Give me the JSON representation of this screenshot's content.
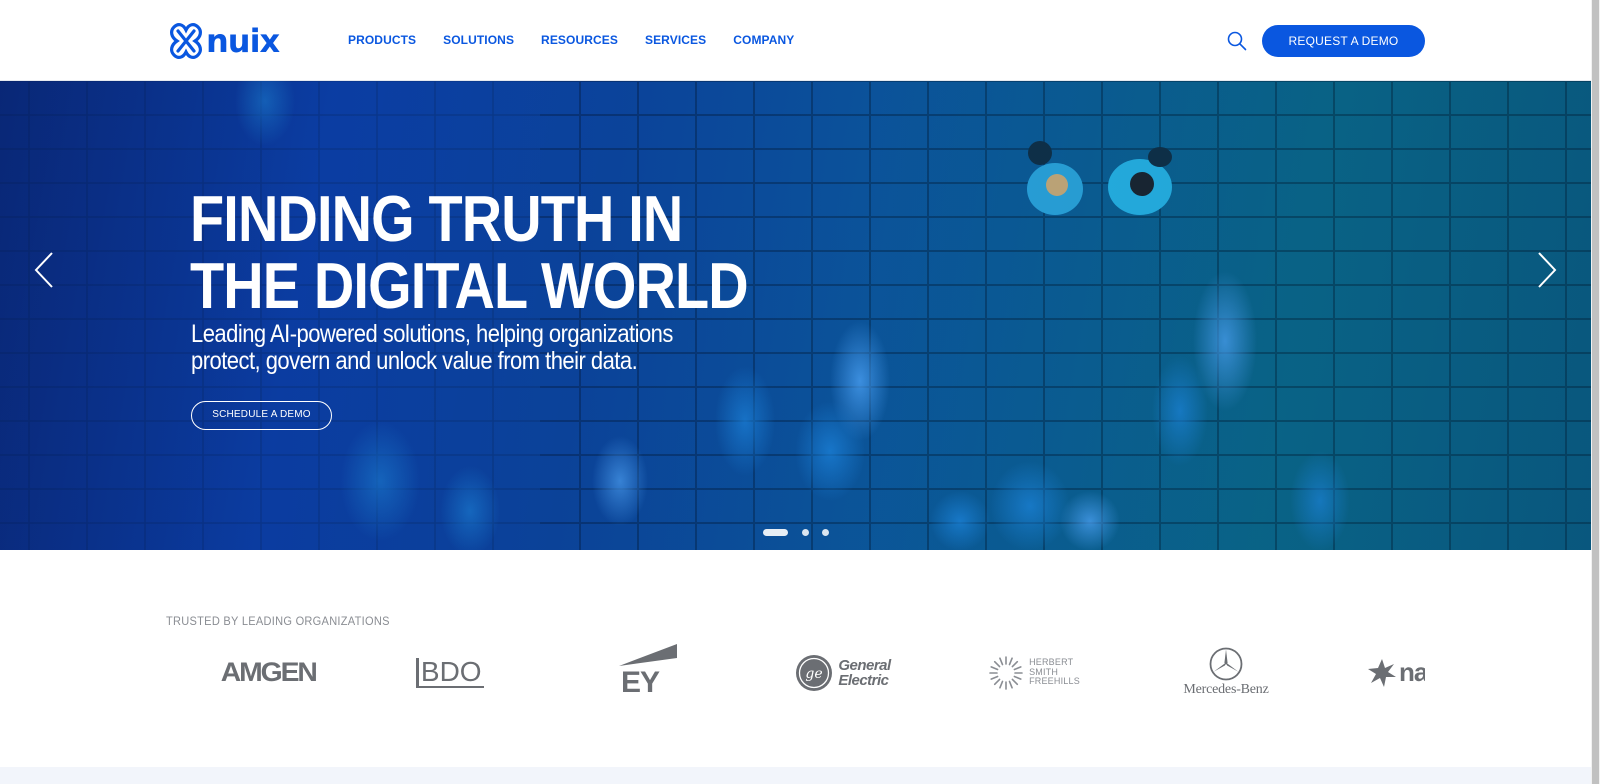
{
  "header": {
    "logo_text": "nuix",
    "nav": [
      "PRODUCTS",
      "SOLUTIONS",
      "RESOURCES",
      "SERVICES",
      "COMPANY"
    ],
    "search_icon": "search-icon",
    "demo_button": "REQUEST A DEMO",
    "brand_color": "#0a57e0"
  },
  "hero": {
    "title_line1": "FINDING TRUTH IN",
    "title_line2": "THE DIGITAL WORLD",
    "subtitle_line1": "Leading AI-powered solutions, helping organizations",
    "subtitle_line2": "protect, govern and unlock value from their data.",
    "cta": "SCHEDULE A DEMO",
    "prev_icon": "chevron-left-icon",
    "next_icon": "chevron-right-icon",
    "slides_count": 3,
    "active_slide": 1
  },
  "trusted": {
    "label": "TRUSTED BY LEADING ORGANIZATIONS",
    "logos": {
      "amgen": "AMGEN",
      "bdo": "BDO",
      "ey": "EY",
      "ge_line1": "General",
      "ge_line2": "Electric",
      "hsf_line1": "HERBERT",
      "hsf_line2": "SMITH",
      "hsf_line3": "FREEHILLS",
      "mercedes": "Mercedes-Benz",
      "nab": "na"
    }
  }
}
